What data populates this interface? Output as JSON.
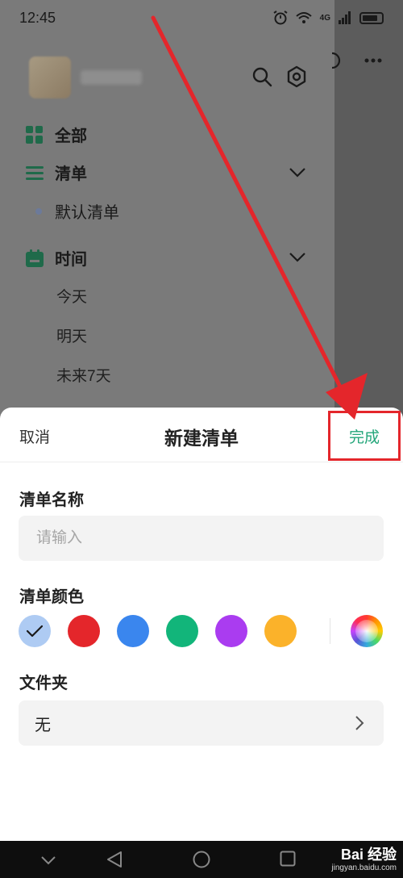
{
  "status_bar": {
    "time": "12:45",
    "network": "4G"
  },
  "drawer": {
    "items": [
      {
        "label": "全部",
        "icon": "grid-icon"
      },
      {
        "label": "清单",
        "icon": "list-icon"
      },
      {
        "label": "默认清单",
        "icon": "dot-icon"
      },
      {
        "label": "时间",
        "icon": "calendar-icon"
      },
      {
        "label": "今天"
      },
      {
        "label": "明天"
      },
      {
        "label": "未来7天"
      }
    ]
  },
  "sheet": {
    "cancel_label": "取消",
    "title": "新建清单",
    "done_label": "完成",
    "name_label": "清单名称",
    "name_placeholder": "请输入",
    "color_label": "清单颜色",
    "colors": [
      "#aecbf3",
      "#e4262b",
      "#3a86ee",
      "#12b57a",
      "#aa3cf0",
      "#fbb22a"
    ],
    "selected_color_index": 0,
    "folder_label": "文件夹",
    "folder_value": "无"
  },
  "accent_color": "#23a67a",
  "highlight_color": "#e4262b",
  "watermark": {
    "brand": "Bai  经验",
    "site": "jingyan.baidu.com"
  }
}
